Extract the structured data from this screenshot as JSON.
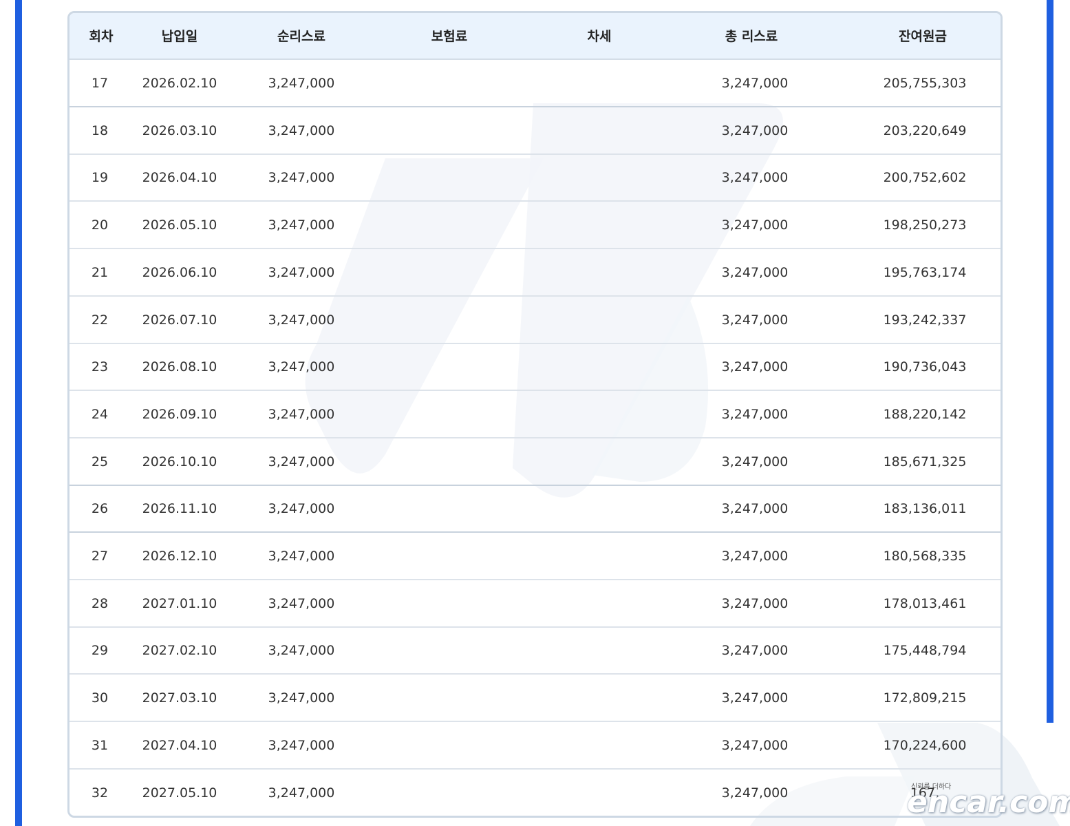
{
  "table": {
    "headers": [
      "회차",
      "납입일",
      "순리스료",
      "보험료",
      "차세",
      "총 리스료",
      "잔여원금"
    ],
    "rows": [
      [
        "17",
        "2026.02.10",
        "3,247,000",
        "",
        "",
        "3,247,000",
        "205,755,303"
      ],
      [
        "18",
        "2026.03.10",
        "3,247,000",
        "",
        "",
        "3,247,000",
        "203,220,649"
      ],
      [
        "19",
        "2026.04.10",
        "3,247,000",
        "",
        "",
        "3,247,000",
        "200,752,602"
      ],
      [
        "20",
        "2026.05.10",
        "3,247,000",
        "",
        "",
        "3,247,000",
        "198,250,273"
      ],
      [
        "21",
        "2026.06.10",
        "3,247,000",
        "",
        "",
        "3,247,000",
        "195,763,174"
      ],
      [
        "22",
        "2026.07.10",
        "3,247,000",
        "",
        "",
        "3,247,000",
        "193,242,337"
      ],
      [
        "23",
        "2026.08.10",
        "3,247,000",
        "",
        "",
        "3,247,000",
        "190,736,043"
      ],
      [
        "24",
        "2026.09.10",
        "3,247,000",
        "",
        "",
        "3,247,000",
        "188,220,142"
      ],
      [
        "25",
        "2026.10.10",
        "3,247,000",
        "",
        "",
        "3,247,000",
        "185,671,325"
      ],
      [
        "26",
        "2026.11.10",
        "3,247,000",
        "",
        "",
        "3,247,000",
        "183,136,011"
      ],
      [
        "27",
        "2026.12.10",
        "3,247,000",
        "",
        "",
        "3,247,000",
        "180,568,335"
      ],
      [
        "28",
        "2027.01.10",
        "3,247,000",
        "",
        "",
        "3,247,000",
        "178,013,461"
      ],
      [
        "29",
        "2027.02.10",
        "3,247,000",
        "",
        "",
        "3,247,000",
        "175,448,794"
      ],
      [
        "30",
        "2027.03.10",
        "3,247,000",
        "",
        "",
        "3,247,000",
        "172,809,215"
      ],
      [
        "31",
        "2027.04.10",
        "3,247,000",
        "",
        "",
        "3,247,000",
        "170,224,600"
      ],
      [
        "32",
        "2027.05.10",
        "3,247,000",
        "",
        "",
        "3,247,000",
        "167,"
      ]
    ]
  },
  "logo": {
    "tagline": "신뢰를 더하다",
    "text": "encar.com"
  },
  "colors": {
    "frame": "#1f5fe0",
    "header_bg": "#eaf3fd",
    "border": "#cdd8e4",
    "watermark": "#eef2f7"
  }
}
